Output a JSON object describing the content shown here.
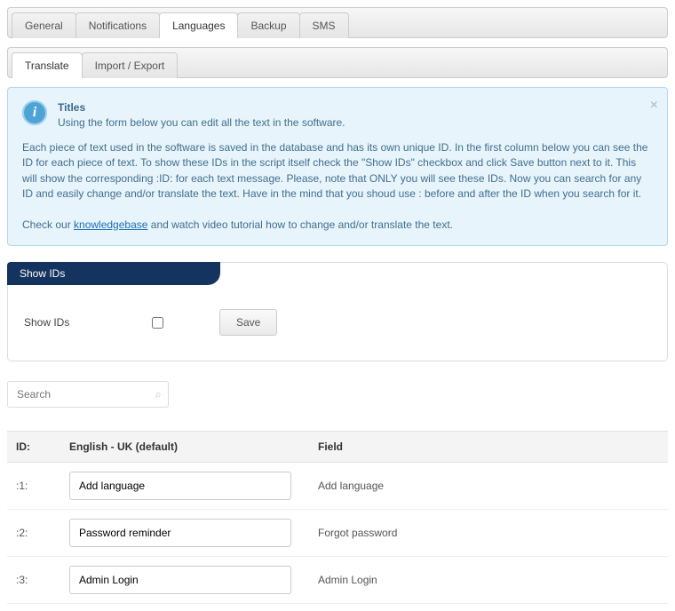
{
  "tabs_primary": [
    {
      "label": "General",
      "active": false
    },
    {
      "label": "Notifications",
      "active": false
    },
    {
      "label": "Languages",
      "active": true
    },
    {
      "label": "Backup",
      "active": false
    },
    {
      "label": "SMS",
      "active": false
    }
  ],
  "tabs_secondary": [
    {
      "label": "Translate",
      "active": true
    },
    {
      "label": "Import / Export",
      "active": false
    }
  ],
  "infobox": {
    "close_glyph": "×",
    "icon_glyph": "i",
    "title": "Titles",
    "subtitle": "Using the form below you can edit all the text in the software.",
    "body": "Each piece of text used in the software is saved in the database and has its own unique ID. In the first column below you can see the ID for each piece of text. To show these IDs in the script itself check the \"Show IDs\" checkbox and click Save button next to it. This will show the corresponding :ID: for each text message. Please, note that ONLY you will see these IDs. Now you can search for any ID and easily change and/or translate the text. Have in the mind that you shoud use : before and after the ID when you search for it.",
    "footer_pre": "Check our ",
    "footer_link": "knowledgebase",
    "footer_post": " and watch video tutorial how to change and/or translate the text."
  },
  "show_ids_panel": {
    "legend": "Show IDs",
    "label": "Show IDs",
    "save": "Save",
    "checked": false
  },
  "search": {
    "placeholder": "Search",
    "icon": "⌕"
  },
  "table": {
    "headers": {
      "id": "ID:",
      "en": "English - UK (default)",
      "field": "Field"
    },
    "rows": [
      {
        "id": ":1:",
        "value": "Add language",
        "field": "Add language"
      },
      {
        "id": ":2:",
        "value": "Password reminder",
        "field": "Forgot password"
      },
      {
        "id": ":3:",
        "value": "Admin Login",
        "field": "Admin Login"
      }
    ]
  }
}
